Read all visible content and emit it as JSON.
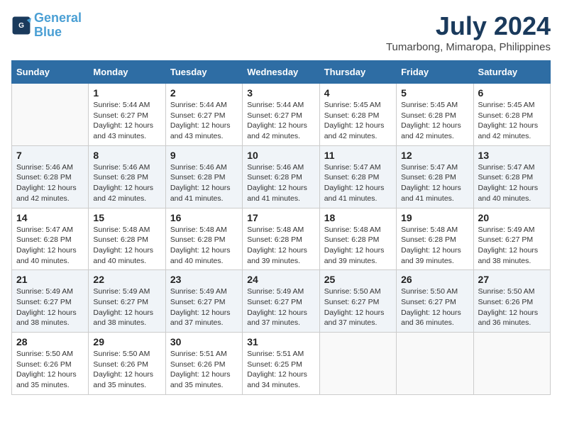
{
  "logo": {
    "line1": "General",
    "line2": "Blue"
  },
  "title": "July 2024",
  "subtitle": "Tumarbong, Mimaropa, Philippines",
  "days_header": [
    "Sunday",
    "Monday",
    "Tuesday",
    "Wednesday",
    "Thursday",
    "Friday",
    "Saturday"
  ],
  "weeks": [
    [
      {
        "day": "",
        "info": ""
      },
      {
        "day": "1",
        "info": "Sunrise: 5:44 AM\nSunset: 6:27 PM\nDaylight: 12 hours\nand 43 minutes."
      },
      {
        "day": "2",
        "info": "Sunrise: 5:44 AM\nSunset: 6:27 PM\nDaylight: 12 hours\nand 43 minutes."
      },
      {
        "day": "3",
        "info": "Sunrise: 5:44 AM\nSunset: 6:27 PM\nDaylight: 12 hours\nand 42 minutes."
      },
      {
        "day": "4",
        "info": "Sunrise: 5:45 AM\nSunset: 6:28 PM\nDaylight: 12 hours\nand 42 minutes."
      },
      {
        "day": "5",
        "info": "Sunrise: 5:45 AM\nSunset: 6:28 PM\nDaylight: 12 hours\nand 42 minutes."
      },
      {
        "day": "6",
        "info": "Sunrise: 5:45 AM\nSunset: 6:28 PM\nDaylight: 12 hours\nand 42 minutes."
      }
    ],
    [
      {
        "day": "7",
        "info": "Sunrise: 5:46 AM\nSunset: 6:28 PM\nDaylight: 12 hours\nand 42 minutes."
      },
      {
        "day": "8",
        "info": "Sunrise: 5:46 AM\nSunset: 6:28 PM\nDaylight: 12 hours\nand 42 minutes."
      },
      {
        "day": "9",
        "info": "Sunrise: 5:46 AM\nSunset: 6:28 PM\nDaylight: 12 hours\nand 41 minutes."
      },
      {
        "day": "10",
        "info": "Sunrise: 5:46 AM\nSunset: 6:28 PM\nDaylight: 12 hours\nand 41 minutes."
      },
      {
        "day": "11",
        "info": "Sunrise: 5:47 AM\nSunset: 6:28 PM\nDaylight: 12 hours\nand 41 minutes."
      },
      {
        "day": "12",
        "info": "Sunrise: 5:47 AM\nSunset: 6:28 PM\nDaylight: 12 hours\nand 41 minutes."
      },
      {
        "day": "13",
        "info": "Sunrise: 5:47 AM\nSunset: 6:28 PM\nDaylight: 12 hours\nand 40 minutes."
      }
    ],
    [
      {
        "day": "14",
        "info": "Sunrise: 5:47 AM\nSunset: 6:28 PM\nDaylight: 12 hours\nand 40 minutes."
      },
      {
        "day": "15",
        "info": "Sunrise: 5:48 AM\nSunset: 6:28 PM\nDaylight: 12 hours\nand 40 minutes."
      },
      {
        "day": "16",
        "info": "Sunrise: 5:48 AM\nSunset: 6:28 PM\nDaylight: 12 hours\nand 40 minutes."
      },
      {
        "day": "17",
        "info": "Sunrise: 5:48 AM\nSunset: 6:28 PM\nDaylight: 12 hours\nand 39 minutes."
      },
      {
        "day": "18",
        "info": "Sunrise: 5:48 AM\nSunset: 6:28 PM\nDaylight: 12 hours\nand 39 minutes."
      },
      {
        "day": "19",
        "info": "Sunrise: 5:48 AM\nSunset: 6:28 PM\nDaylight: 12 hours\nand 39 minutes."
      },
      {
        "day": "20",
        "info": "Sunrise: 5:49 AM\nSunset: 6:27 PM\nDaylight: 12 hours\nand 38 minutes."
      }
    ],
    [
      {
        "day": "21",
        "info": "Sunrise: 5:49 AM\nSunset: 6:27 PM\nDaylight: 12 hours\nand 38 minutes."
      },
      {
        "day": "22",
        "info": "Sunrise: 5:49 AM\nSunset: 6:27 PM\nDaylight: 12 hours\nand 38 minutes."
      },
      {
        "day": "23",
        "info": "Sunrise: 5:49 AM\nSunset: 6:27 PM\nDaylight: 12 hours\nand 37 minutes."
      },
      {
        "day": "24",
        "info": "Sunrise: 5:49 AM\nSunset: 6:27 PM\nDaylight: 12 hours\nand 37 minutes."
      },
      {
        "day": "25",
        "info": "Sunrise: 5:50 AM\nSunset: 6:27 PM\nDaylight: 12 hours\nand 37 minutes."
      },
      {
        "day": "26",
        "info": "Sunrise: 5:50 AM\nSunset: 6:27 PM\nDaylight: 12 hours\nand 36 minutes."
      },
      {
        "day": "27",
        "info": "Sunrise: 5:50 AM\nSunset: 6:26 PM\nDaylight: 12 hours\nand 36 minutes."
      }
    ],
    [
      {
        "day": "28",
        "info": "Sunrise: 5:50 AM\nSunset: 6:26 PM\nDaylight: 12 hours\nand 35 minutes."
      },
      {
        "day": "29",
        "info": "Sunrise: 5:50 AM\nSunset: 6:26 PM\nDaylight: 12 hours\nand 35 minutes."
      },
      {
        "day": "30",
        "info": "Sunrise: 5:51 AM\nSunset: 6:26 PM\nDaylight: 12 hours\nand 35 minutes."
      },
      {
        "day": "31",
        "info": "Sunrise: 5:51 AM\nSunset: 6:25 PM\nDaylight: 12 hours\nand 34 minutes."
      },
      {
        "day": "",
        "info": ""
      },
      {
        "day": "",
        "info": ""
      },
      {
        "day": "",
        "info": ""
      }
    ]
  ]
}
